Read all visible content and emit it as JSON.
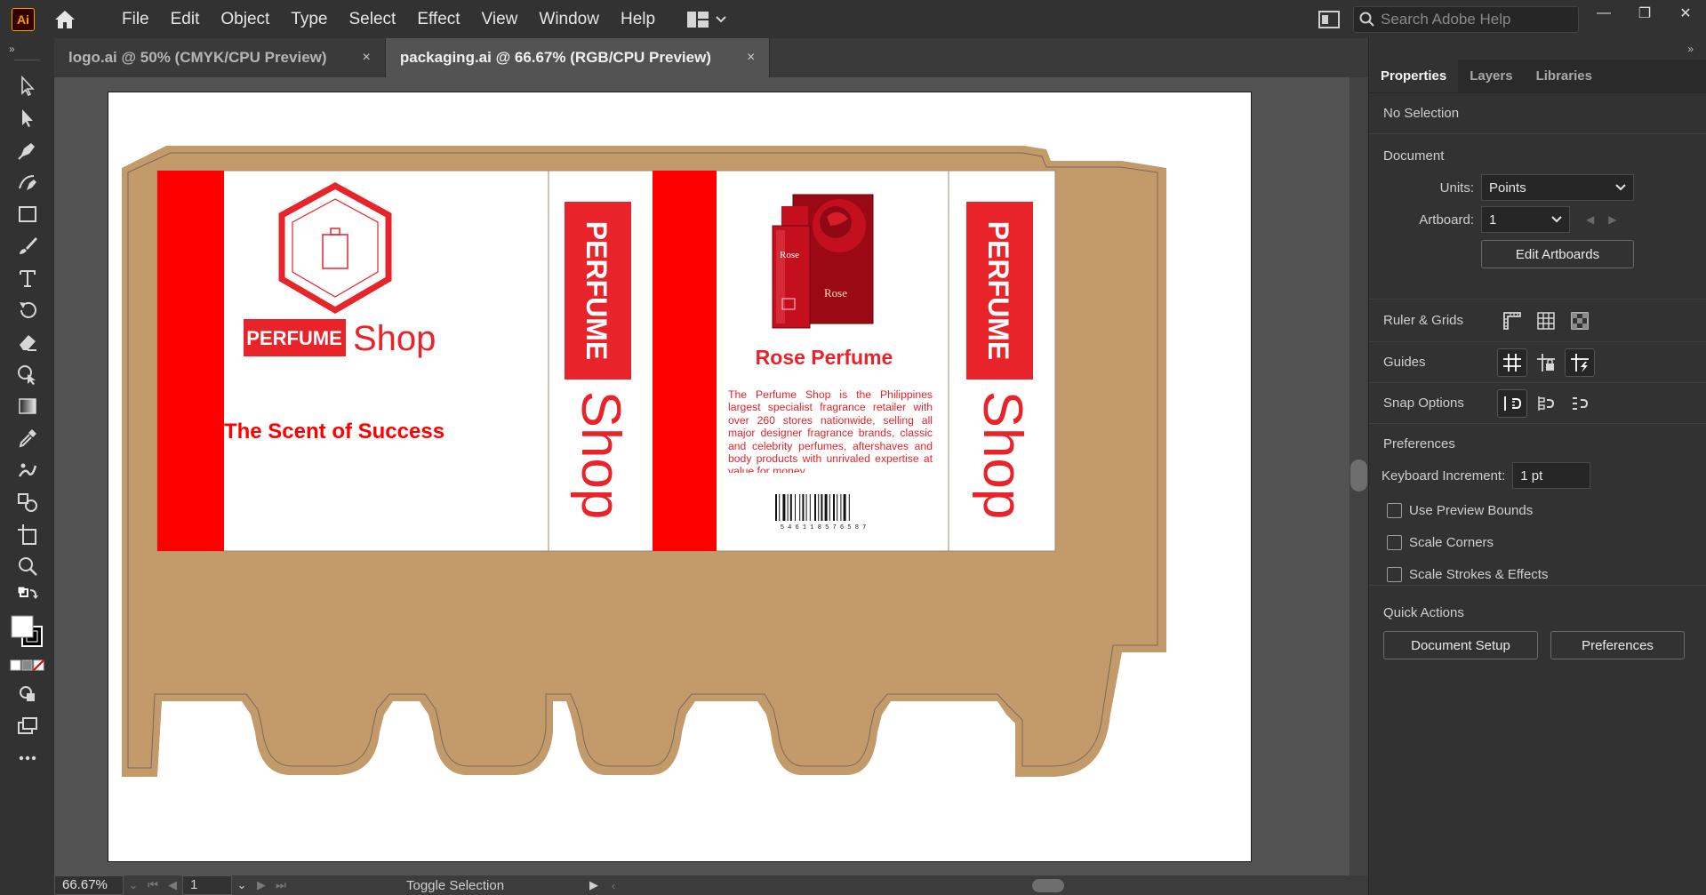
{
  "app": {
    "logo": "Ai",
    "brand_color": "#ff9a00"
  },
  "menu": [
    "File",
    "Edit",
    "Object",
    "Type",
    "Select",
    "Effect",
    "View",
    "Window",
    "Help"
  ],
  "search": {
    "placeholder": "Search Adobe Help"
  },
  "window_controls": {
    "minimize": "—",
    "restore": "❐",
    "close": "✕"
  },
  "tabs": [
    {
      "label": "logo.ai @ 50% (CMYK/CPU Preview)",
      "active": false,
      "close": "×"
    },
    {
      "label": "packaging.ai @ 66.67% (RGB/CPU Preview)",
      "active": true,
      "close": "×"
    }
  ],
  "design": {
    "kraft_color": "#c39a6a",
    "accent_color": "#ff0000",
    "logo_word": "PERFUME",
    "logo_shop": "Shop",
    "tagline": "The Scent of Success",
    "side_word": "PERFUME",
    "side_shop": "Shop",
    "product_title": "Rose Perfume",
    "product_box_text": "Rose",
    "product_bottle_text": "Rose",
    "description": "The Perfume Shop is the Philippines largest specialist fragrance retailer with over 260 stores nationwide, selling all major designer fragrance brands, classic and celebrity perfumes, aftershaves and body products with unrivaled expertise at value for money",
    "barcode_number": "5 4 6 1 1 8 5 7 6 5 8 7"
  },
  "status": {
    "zoom": "66.67%",
    "artboard": "1",
    "toggle": "Toggle Selection"
  },
  "panel": {
    "tabs": [
      "Properties",
      "Layers",
      "Libraries"
    ],
    "selection": "No Selection",
    "document": {
      "title": "Document",
      "units_label": "Units:",
      "units_value": "Points",
      "artboard_label": "Artboard:",
      "artboard_value": "1",
      "edit_artboards": "Edit Artboards"
    },
    "ruler_grids": "Ruler & Grids",
    "guides": "Guides",
    "snap_options": "Snap Options",
    "preferences": {
      "title": "Preferences",
      "keyboard_label": "Keyboard Increment:",
      "keyboard_value": "1 pt",
      "use_preview_bounds": "Use Preview Bounds",
      "scale_corners": "Scale Corners",
      "scale_strokes": "Scale Strokes & Effects"
    },
    "quick_actions": {
      "title": "Quick Actions",
      "document_setup": "Document Setup",
      "preferences": "Preferences"
    }
  }
}
